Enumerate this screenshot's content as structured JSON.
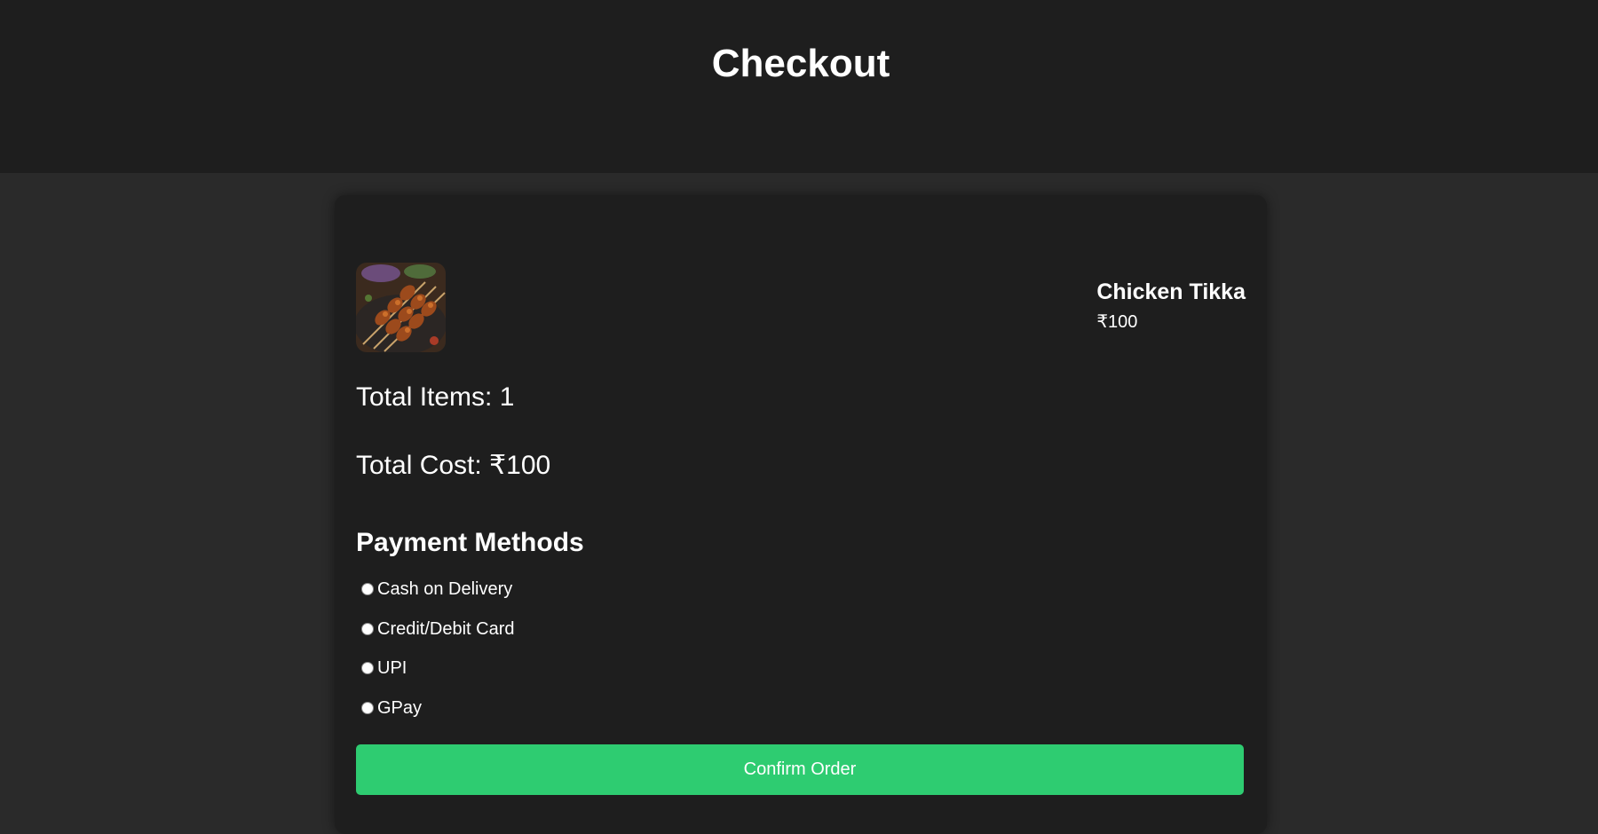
{
  "header": {
    "title": "Checkout"
  },
  "cart": {
    "items": [
      {
        "name": "Chicken Tikka",
        "price": "₹100",
        "image_icon": "chicken-tikka-skewers-image"
      }
    ],
    "total_items": "Total Items: 1",
    "total_cost": "Total Cost: ₹100"
  },
  "payment": {
    "title": "Payment Methods",
    "options": [
      {
        "label": "Cash on Delivery",
        "selected": false
      },
      {
        "label": "Credit/Debit Card",
        "selected": false
      },
      {
        "label": "UPI",
        "selected": false
      },
      {
        "label": "GPay",
        "selected": false
      }
    ]
  },
  "actions": {
    "confirm_label": "Confirm Order"
  },
  "colors": {
    "page_background": "#2a2a2a",
    "header_background": "#1e1e1e",
    "card_background": "#1e1e1e",
    "accent": "#2ecc71",
    "text": "#ffffff"
  }
}
